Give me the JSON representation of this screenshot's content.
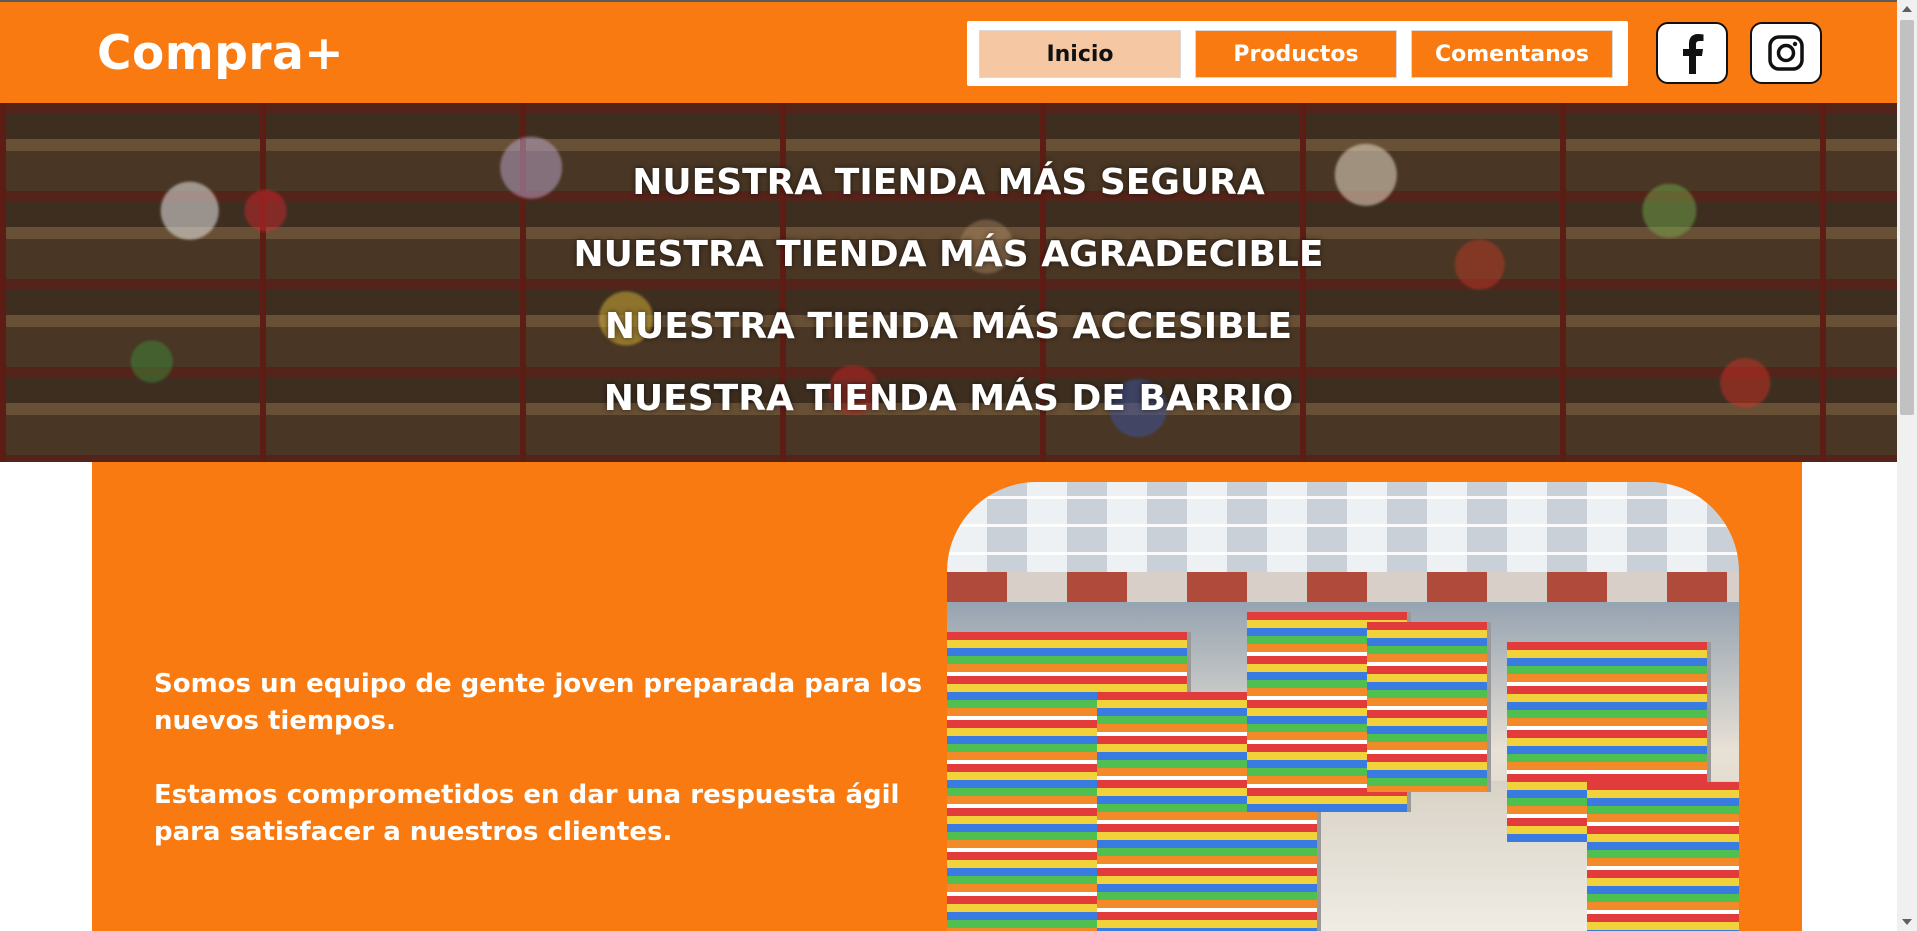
{
  "header": {
    "logo": "Compra+",
    "nav": [
      {
        "label": "Inicio",
        "active": true
      },
      {
        "label": "Productos",
        "active": false
      },
      {
        "label": "Comentanos",
        "active": false
      }
    ],
    "social": [
      {
        "icon": "facebook-icon"
      },
      {
        "icon": "instagram-icon"
      }
    ]
  },
  "hero": {
    "lines": [
      "NUESTRA TIENDA MÁS SEGURA",
      "NUESTRA TIENDA MÁS AGRADECIBLE",
      "NUESTRA TIENDA MÁS ACCESIBLE",
      "NUESTRA TIENDA MÁS DE BARRIO"
    ]
  },
  "about": {
    "paragraph1": "Somos un equipo de gente joven preparada para los nuevos tiempos.",
    "paragraph2": "Estamos comprometidos en dar una respuesta ágil para satisfacer a nuestros clientes."
  },
  "colors": {
    "brand": "#f97a10",
    "nav_active": "#f5c7a2"
  }
}
